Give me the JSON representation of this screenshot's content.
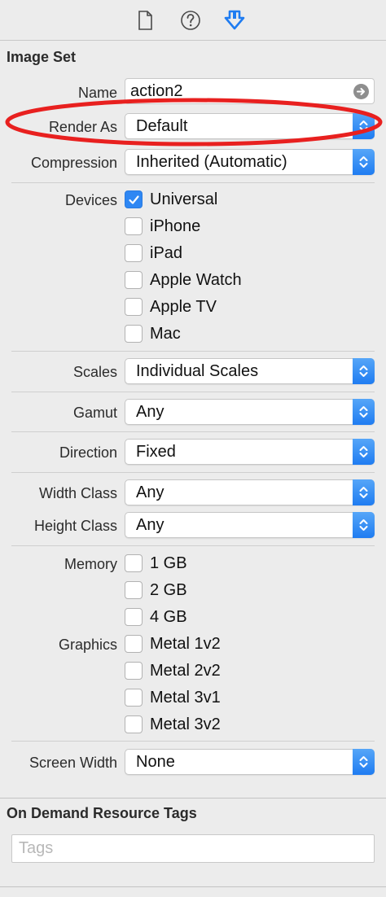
{
  "section_title": "Image Set",
  "fields": {
    "name": {
      "label": "Name",
      "value": "action2"
    },
    "render_as": {
      "label": "Render As",
      "value": "Default"
    },
    "compression": {
      "label": "Compression",
      "value": "Inherited (Automatic)"
    }
  },
  "devices": {
    "label": "Devices",
    "items": [
      {
        "label": "Universal",
        "checked": true
      },
      {
        "label": "iPhone",
        "checked": false
      },
      {
        "label": "iPad",
        "checked": false
      },
      {
        "label": "Apple Watch",
        "checked": false
      },
      {
        "label": "Apple TV",
        "checked": false
      },
      {
        "label": "Mac",
        "checked": false
      }
    ]
  },
  "scales": {
    "label": "Scales",
    "value": "Individual Scales"
  },
  "gamut": {
    "label": "Gamut",
    "value": "Any"
  },
  "direction": {
    "label": "Direction",
    "value": "Fixed"
  },
  "width_class": {
    "label": "Width Class",
    "value": "Any"
  },
  "height_class": {
    "label": "Height Class",
    "value": "Any"
  },
  "memory": {
    "label": "Memory",
    "items": [
      {
        "label": "1 GB",
        "checked": false
      },
      {
        "label": "2 GB",
        "checked": false
      },
      {
        "label": "4 GB",
        "checked": false
      }
    ]
  },
  "graphics": {
    "label": "Graphics",
    "items": [
      {
        "label": "Metal 1v2",
        "checked": false
      },
      {
        "label": "Metal 2v2",
        "checked": false
      },
      {
        "label": "Metal 3v1",
        "checked": false
      },
      {
        "label": "Metal 3v2",
        "checked": false
      }
    ]
  },
  "screen_width": {
    "label": "Screen Width",
    "value": "None"
  },
  "on_demand": {
    "title": "On Demand Resource Tags",
    "tags_placeholder": "Tags"
  },
  "tabs": [
    {
      "icon": "file-icon",
      "active": false
    },
    {
      "icon": "help-icon",
      "active": false
    },
    {
      "icon": "attributes-inspector-icon",
      "active": true
    }
  ],
  "colors": {
    "accent": "#2f87f3",
    "annotation": "#e8201f",
    "background": "#ececec"
  }
}
